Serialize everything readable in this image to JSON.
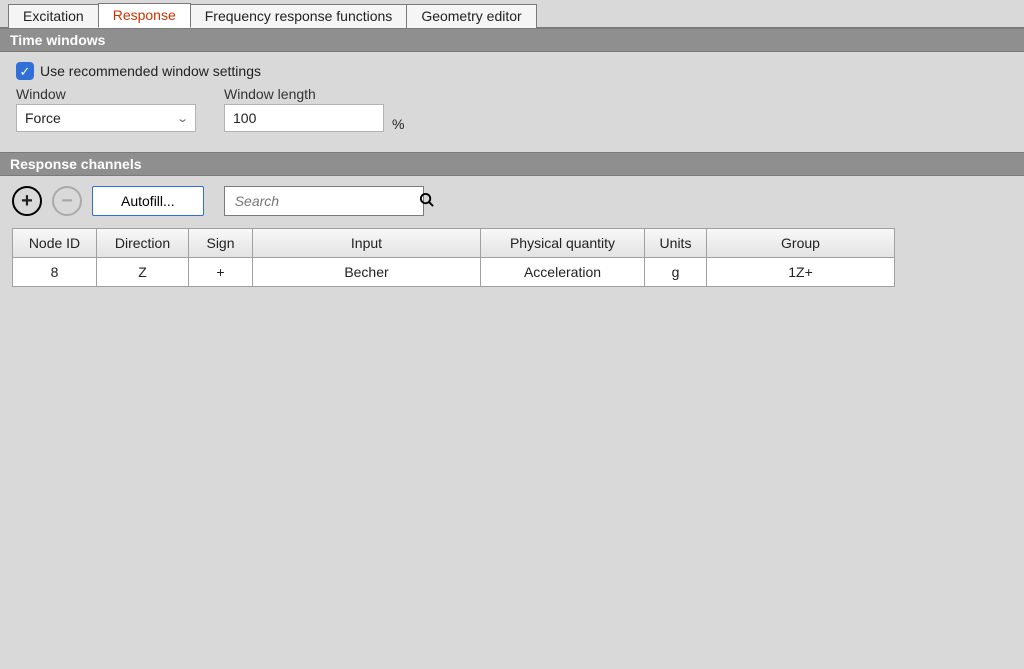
{
  "tabs": {
    "excitation": "Excitation",
    "response": "Response",
    "frf": "Frequency response functions",
    "geometry": "Geometry editor"
  },
  "time_windows": {
    "header": "Time windows",
    "use_recommended_label": "Use recommended window settings",
    "window_label": "Window",
    "window_value": "Force",
    "window_length_label": "Window length",
    "window_length_value": "100",
    "window_length_unit": "%"
  },
  "response_channels": {
    "header": "Response channels",
    "autofill_label": "Autofill...",
    "search_placeholder": "Search",
    "columns": {
      "node_id": "Node ID",
      "direction": "Direction",
      "sign": "Sign",
      "input": "Input",
      "physical_quantity": "Physical quantity",
      "units": "Units",
      "group": "Group"
    },
    "rows": [
      {
        "node_id": "8",
        "direction": "Z",
        "sign": "+",
        "input": "Becher",
        "physical_quantity": "Acceleration",
        "units": "g",
        "group": "1Z+"
      }
    ]
  }
}
